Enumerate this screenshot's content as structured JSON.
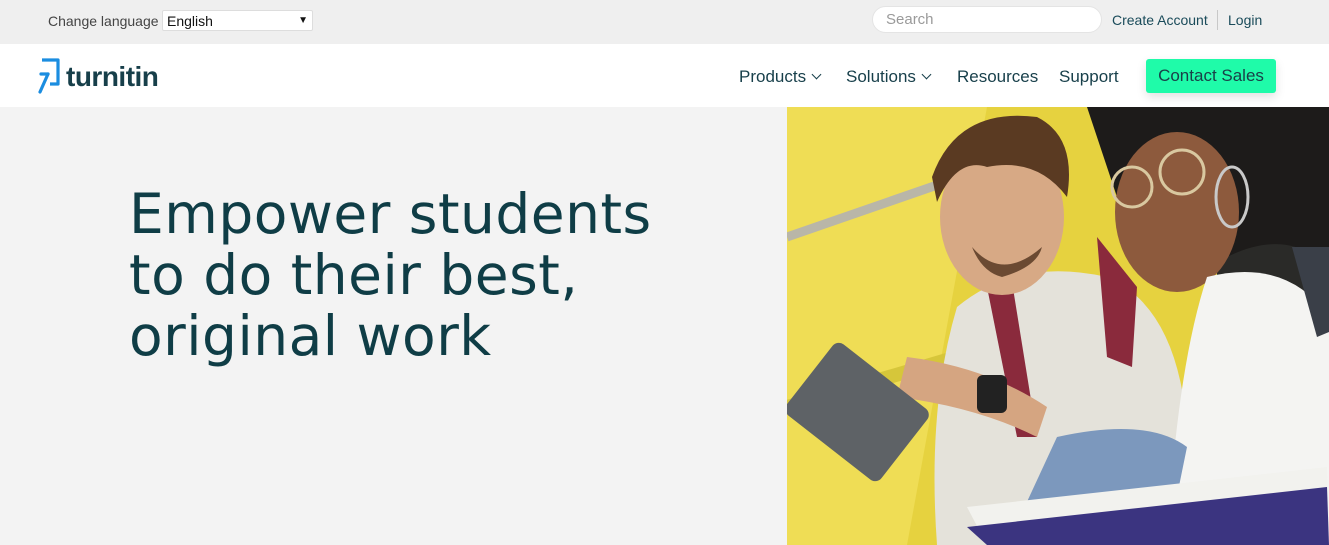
{
  "utility_bar": {
    "change_language_label": "Change language",
    "language_selected": "English",
    "search_placeholder": "Search",
    "create_account": "Create Account",
    "login": "Login"
  },
  "nav": {
    "logo_text": "turnitin",
    "items": [
      {
        "label": "Products"
      },
      {
        "label": "Solutions"
      },
      {
        "label": "Resources"
      },
      {
        "label": "Support"
      }
    ],
    "contact_sales": "Contact Sales"
  },
  "hero": {
    "title_lines": [
      "Empower students",
      "to do their best,",
      "original work"
    ]
  },
  "colors": {
    "accent_button": "#1ffba9",
    "brand_dark": "#173f4a",
    "logo_blue": "#1b8de0"
  }
}
